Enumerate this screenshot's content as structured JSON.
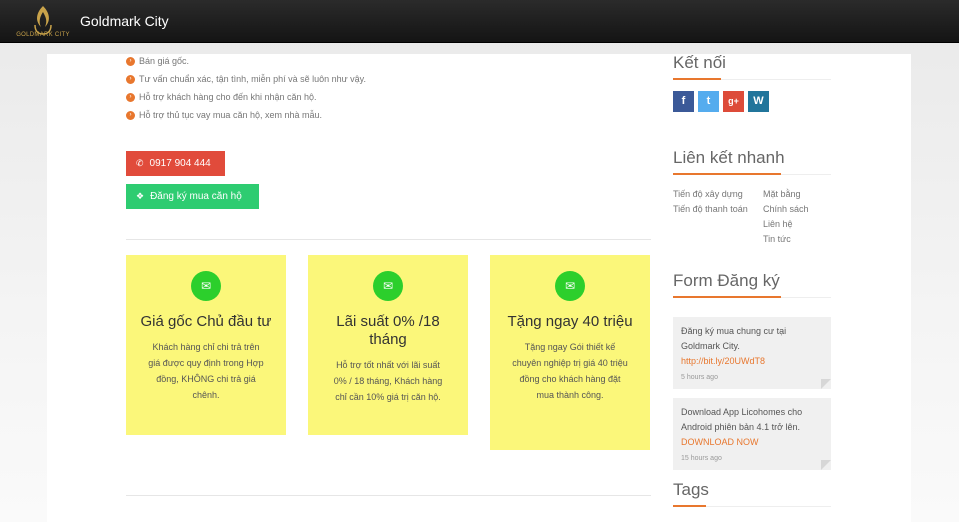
{
  "header": {
    "logo_text": "GOLDMARK CITY",
    "site_title": "Goldmark City"
  },
  "benefits": [
    "Bán giá gốc.",
    "Tư vấn chuẩn xác, tận tình, miễn phí và sẽ luôn như vậy.",
    "Hỗ trợ khách hàng cho đến khi nhận căn hộ.",
    "Hỗ trợ thủ tục vay mua căn hộ, xem nhà mẫu."
  ],
  "buttons": {
    "phone": "0917 904 444",
    "register": "Đăng ký mua căn hộ"
  },
  "cards": [
    {
      "title": "Giá gốc Chủ đầu tư",
      "text": "Khách hàng chỉ chi trả trên giá được quy định trong Hợp đồng, KHÔNG chi trả giá chênh."
    },
    {
      "title": "Lãi suất 0% /18 tháng",
      "text": "Hỗ trợ tốt nhất với lãi suất 0% / 18 tháng, Khách hàng chỉ cần 10% giá trị căn hộ."
    },
    {
      "title": "Tặng ngay 40 triệu",
      "text": "Tặng ngay Gói thiết kế chuyên nghiệp trị giá 40 triệu đồng cho khách hàng đặt mua thành công."
    }
  ],
  "sidebar": {
    "connect_title": "Kết nối",
    "social_icons": [
      "facebook-icon",
      "twitter-icon",
      "google-plus-icon",
      "wordpress-icon"
    ],
    "quick_links_title": "Liên kết nhanh",
    "quick_links_left": [
      "Tiến độ xây dựng",
      "Tiến độ thanh toán"
    ],
    "quick_links_right": [
      "Mặt bằng",
      "Chính sách",
      "Liên hệ",
      "Tin tức"
    ],
    "form_title": "Form Đăng ký",
    "notices": [
      {
        "text": "Đăng ký mua chung cư tại Goldmark City.",
        "link": "http://bit.ly/20UWdT8",
        "time": "5 hours ago"
      },
      {
        "text": "Download App Licohomes cho Android phiên bản 4.1 trở lên.",
        "link": "DOWNLOAD NOW",
        "time": "15 hours ago"
      }
    ],
    "tags_title": "Tags"
  },
  "colors": {
    "accent": "#e8772e",
    "phone_button": "#e14b3b",
    "register_button": "#2ecc71",
    "card_bg": "#fbf77a",
    "card_icon": "#2ccf2c"
  }
}
